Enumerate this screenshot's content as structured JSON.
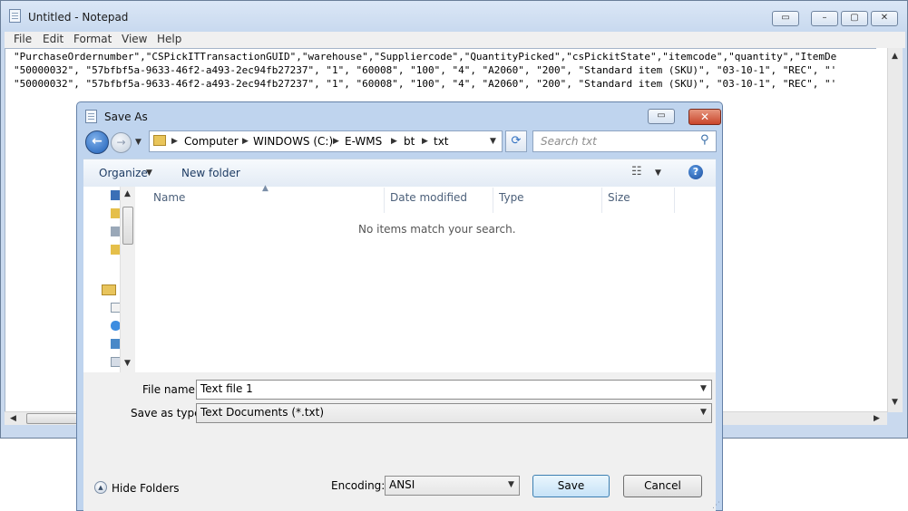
{
  "notepad": {
    "title": "Untitled - Notepad",
    "menu": [
      "File",
      "Edit",
      "Format",
      "View",
      "Help"
    ],
    "lines": [
      "\"PurchaseOrdernumber\",\"CSPickITTransactionGUID\",\"warehouse\",\"Suppliercode\",\"QuantityPicked\",\"csPickitState\",\"itemcode\",\"quantity\",\"ItemDe",
      "\"50000032\", \"57bfbf5a-9633-46f2-a493-2ec94fb27237\", \"1\", \"60008\", \"100\", \"4\", \"A2060\", \"200\", \"Standard item (SKU)\", \"03-10-1\", \"REC\", \"'",
      "\"50000032\", \"57bfbf5a-9633-46f2-a493-2ec94fb27237\", \"1\", \"60008\", \"100\", \"4\", \"A2060\", \"200\", \"Standard item (SKU)\", \"03-10-1\", \"REC\", \"'"
    ]
  },
  "dialog": {
    "title": "Save As",
    "breadcrumb": [
      "Computer",
      "WINDOWS (C:)",
      "E-WMS",
      "bt",
      "txt"
    ],
    "search_placeholder": "Search txt",
    "organize_label": "Organize",
    "new_folder_label": "New folder",
    "columns": [
      "Name",
      "Date modified",
      "Type",
      "Size"
    ],
    "empty_message": "No items match your search.",
    "file_name_label": "File name:",
    "file_name_value": "Text file 1",
    "save_as_type_label": "Save as type:",
    "save_as_type_value": "Text Documents (*.txt)",
    "hide_folders_label": "Hide Folders",
    "encoding_label": "Encoding:",
    "encoding_value": "ANSI",
    "save_label": "Save",
    "cancel_label": "Cancel"
  }
}
